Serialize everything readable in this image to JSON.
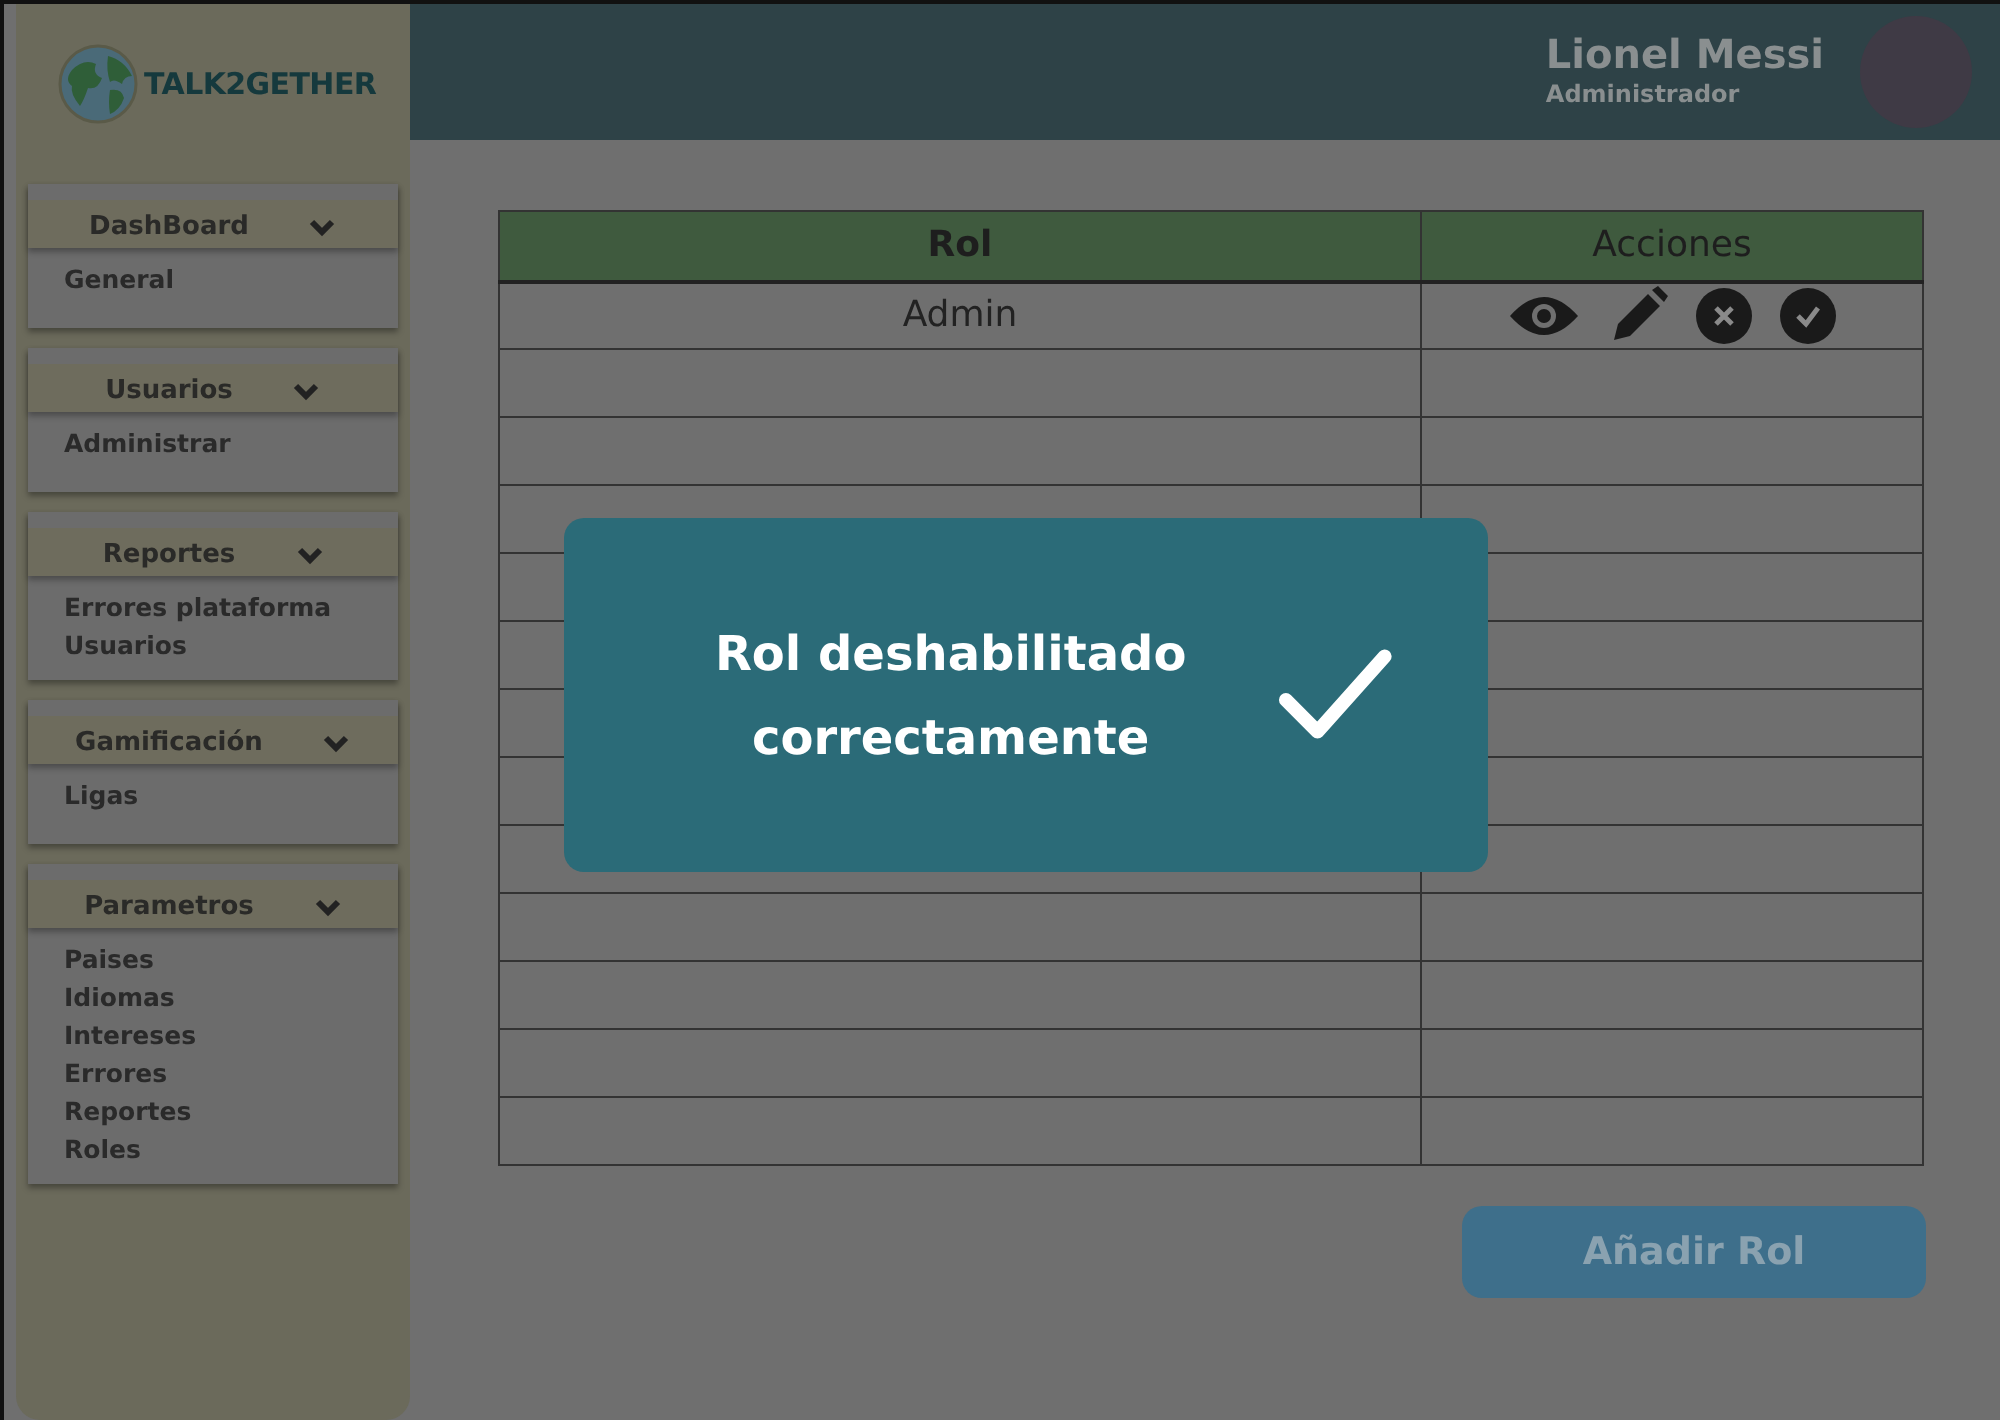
{
  "logo": {
    "text": "TALK2GETHER"
  },
  "user": {
    "name": "Lionel Messi",
    "role": "Administrador"
  },
  "sidebar": [
    {
      "title": "DashBoard",
      "items": [
        "General"
      ]
    },
    {
      "title": "Usuarios",
      "items": [
        "Administrar"
      ]
    },
    {
      "title": "Reportes",
      "items": [
        "Errores plataforma",
        "Usuarios"
      ]
    },
    {
      "title": "Gamificación",
      "items": [
        "Ligas"
      ]
    },
    {
      "title": "Parametros",
      "items": [
        "Paises",
        "Idiomas",
        "Intereses",
        "Errores",
        "Reportes",
        "Roles"
      ]
    }
  ],
  "table": {
    "columns": [
      "Rol",
      "Acciones"
    ],
    "rows": [
      {
        "rol": "Admin",
        "has_actions": true
      },
      {
        "has_actions": false
      },
      {
        "has_actions": false
      },
      {
        "has_actions": false
      },
      {
        "has_actions": false
      },
      {
        "has_actions": false
      },
      {
        "has_actions": false
      },
      {
        "has_actions": false
      },
      {
        "has_actions": false
      },
      {
        "has_actions": false
      },
      {
        "has_actions": false
      },
      {
        "has_actions": false
      },
      {
        "has_actions": false
      }
    ]
  },
  "modal": {
    "message": "Rol deshabilitado correctamente"
  },
  "add_button": {
    "label": "Añadir Rol"
  }
}
